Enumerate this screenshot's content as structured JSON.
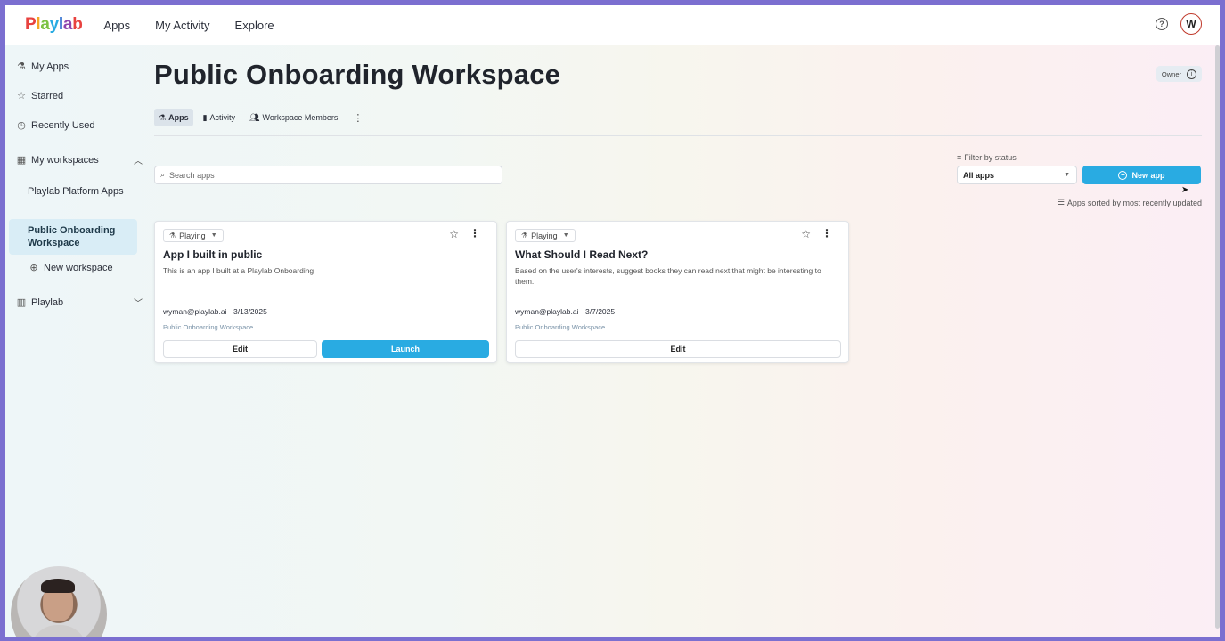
{
  "brand": {
    "name": "Playlab",
    "letter_colors": [
      "#e8423f",
      "#f5a623",
      "#7cc242",
      "#29abe2",
      "#2f6fd0",
      "#8e44ad",
      "#e8423f"
    ]
  },
  "topnav": {
    "items": [
      "Apps",
      "My Activity",
      "Explore"
    ]
  },
  "user": {
    "initial": "W"
  },
  "sidebar": {
    "my_apps": "My Apps",
    "starred": "Starred",
    "recently_used": "Recently Used",
    "my_workspaces": "My workspaces",
    "workspaces": [
      "Playlab Platform Apps",
      "Public Onboarding Workspace"
    ],
    "new_workspace": "New workspace",
    "playlab": "Playlab"
  },
  "page": {
    "title": "Public Onboarding Workspace",
    "role_badge": "Owner",
    "tabs": [
      "Apps",
      "Activity",
      "Workspace Members"
    ]
  },
  "controls": {
    "search_placeholder": "Search apps",
    "filter_label": "Filter by status",
    "filter_value": "All apps",
    "new_app": "New app",
    "sort_note": "Apps sorted by most recently updated"
  },
  "apps": [
    {
      "status": "Playing",
      "title": "App I built in public",
      "description": "This is an app I built at a Playlab Onboarding",
      "meta": "wyman@playlab.ai · 3/13/2025",
      "workspace": "Public Onboarding Workspace",
      "edit_label": "Edit",
      "launch_label": "Launch"
    },
    {
      "status": "Playing",
      "title": "What Should I Read Next?",
      "description": "Based on the user's interests, suggest books they can read next that might be interesting to them.",
      "meta": "wyman@playlab.ai · 3/7/2025",
      "workspace": "Public Onboarding Workspace",
      "edit_label": "Edit"
    }
  ],
  "colors": {
    "accent": "#29abe2",
    "active_item_bg": "#d9edf6"
  }
}
